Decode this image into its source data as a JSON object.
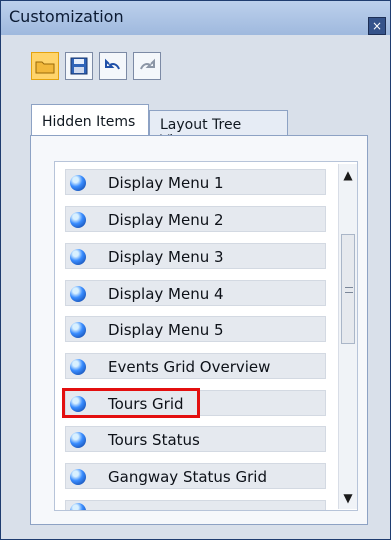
{
  "window": {
    "title": "Customization",
    "close_glyph": "×"
  },
  "toolbar": {
    "buttons": [
      {
        "icon": "open-folder-icon"
      },
      {
        "icon": "save-icon"
      },
      {
        "icon": "undo-icon"
      },
      {
        "icon": "redo-icon"
      }
    ]
  },
  "tabs": [
    {
      "label": "Hidden Items",
      "selected": true
    },
    {
      "label": "Layout Tree View",
      "selected": false
    }
  ],
  "hidden_items": [
    {
      "label": "Display Menu 1"
    },
    {
      "label": "Display Menu 2"
    },
    {
      "label": "Display Menu 3"
    },
    {
      "label": "Display Menu 4"
    },
    {
      "label": "Display Menu 5"
    },
    {
      "label": "Events Grid Overview"
    },
    {
      "label": "Tours Grid",
      "highlighted": true
    },
    {
      "label": "Tours Status"
    },
    {
      "label": "Gangway Status Grid"
    }
  ],
  "colors": {
    "highlight": "#e30f0f",
    "accent_blue": "#3a8dff"
  }
}
